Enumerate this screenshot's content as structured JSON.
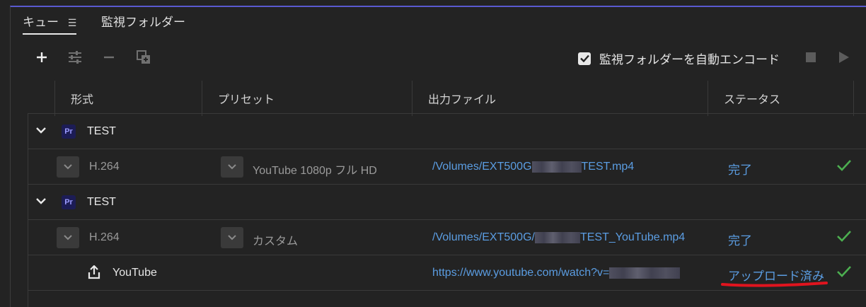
{
  "tabs": {
    "queue_label": "キュー",
    "watch_label": "監視フォルダー"
  },
  "toolbar": {
    "auto_encode_label": "監視フォルダーを自動エンコード",
    "auto_encode_checked": true
  },
  "columns": {
    "format": "形式",
    "preset": "プリセット",
    "output": "出力ファイル",
    "status": "ステータス"
  },
  "groups": [
    {
      "title": "TEST",
      "badge": "Pr",
      "item": {
        "format": "H.264",
        "preset": "YouTube 1080p フル HD",
        "output_prefix": "/Volumes/EXT500G",
        "output_suffix": "TEST.mp4",
        "status": "完了"
      }
    },
    {
      "title": "TEST",
      "badge": "Pr",
      "item": {
        "format": "H.264",
        "preset": "カスタム",
        "output_prefix": "/Volumes/EXT500G/",
        "output_suffix": "TEST_YouTube.mp4",
        "status": "完了"
      },
      "publish": {
        "name": "YouTube",
        "url": "https://www.youtube.com/watch?v=",
        "status": "アップロード済み"
      }
    }
  ],
  "colors": {
    "accent": "#5b9de2",
    "success": "#4caf50",
    "annotation": "#e0141e"
  }
}
